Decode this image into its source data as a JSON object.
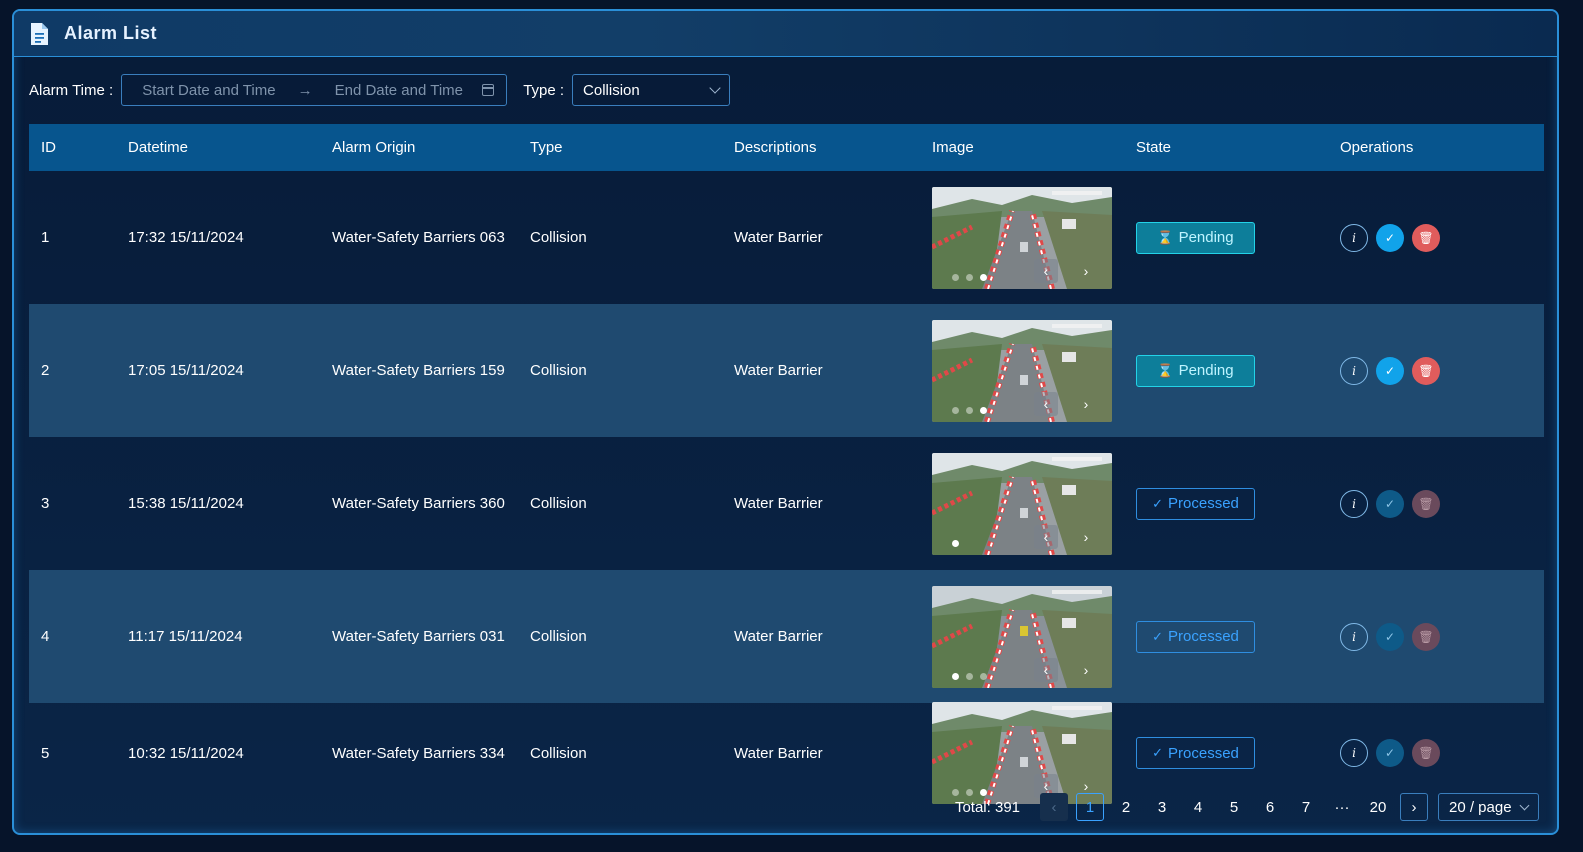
{
  "header": {
    "title": "Alarm List",
    "icon": "document-icon"
  },
  "filters": {
    "alarm_time_label": "Alarm Time :",
    "start_placeholder": "Start Date and Time",
    "end_placeholder": "End Date and Time",
    "type_label": "Type :",
    "type_value": "Collision"
  },
  "table": {
    "columns": [
      "ID",
      "Datetime",
      "Alarm Origin",
      "Type",
      "Descriptions",
      "Image",
      "State",
      "Operations"
    ],
    "rows": [
      {
        "id": "1",
        "datetime": "17:32 15/11/2024",
        "origin": "Water-Safety Barriers 063",
        "type": "Collision",
        "description": "Water Barrier",
        "state": "Pending"
      },
      {
        "id": "2",
        "datetime": "17:05 15/11/2024",
        "origin": "Water-Safety Barriers 159",
        "type": "Collision",
        "description": "Water Barrier",
        "state": "Pending"
      },
      {
        "id": "3",
        "datetime": "15:38 15/11/2024",
        "origin": "Water-Safety Barriers 360",
        "type": "Collision",
        "description": "Water Barrier",
        "state": "Processed"
      },
      {
        "id": "4",
        "datetime": "11:17 15/11/2024",
        "origin": "Water-Safety Barriers 031",
        "type": "Collision",
        "description": "Water Barrier",
        "state": "Processed"
      },
      {
        "id": "5",
        "datetime": "10:32 15/11/2024",
        "origin": "Water-Safety Barriers 334",
        "type": "Collision",
        "description": "Water Barrier",
        "state": "Processed"
      }
    ]
  },
  "pagination": {
    "total": "Total: 391",
    "pages": [
      "1",
      "2",
      "3",
      "4",
      "5",
      "6",
      "7"
    ],
    "ellipsis": "···",
    "last_page": "20",
    "current": "1",
    "page_size": "20 / page"
  },
  "colors": {
    "accent": "#2a8fd8",
    "header_row": "#07558e",
    "pending": "#0d7e9a",
    "processed": "#3aa2ff",
    "delete": "#e05c5c"
  }
}
